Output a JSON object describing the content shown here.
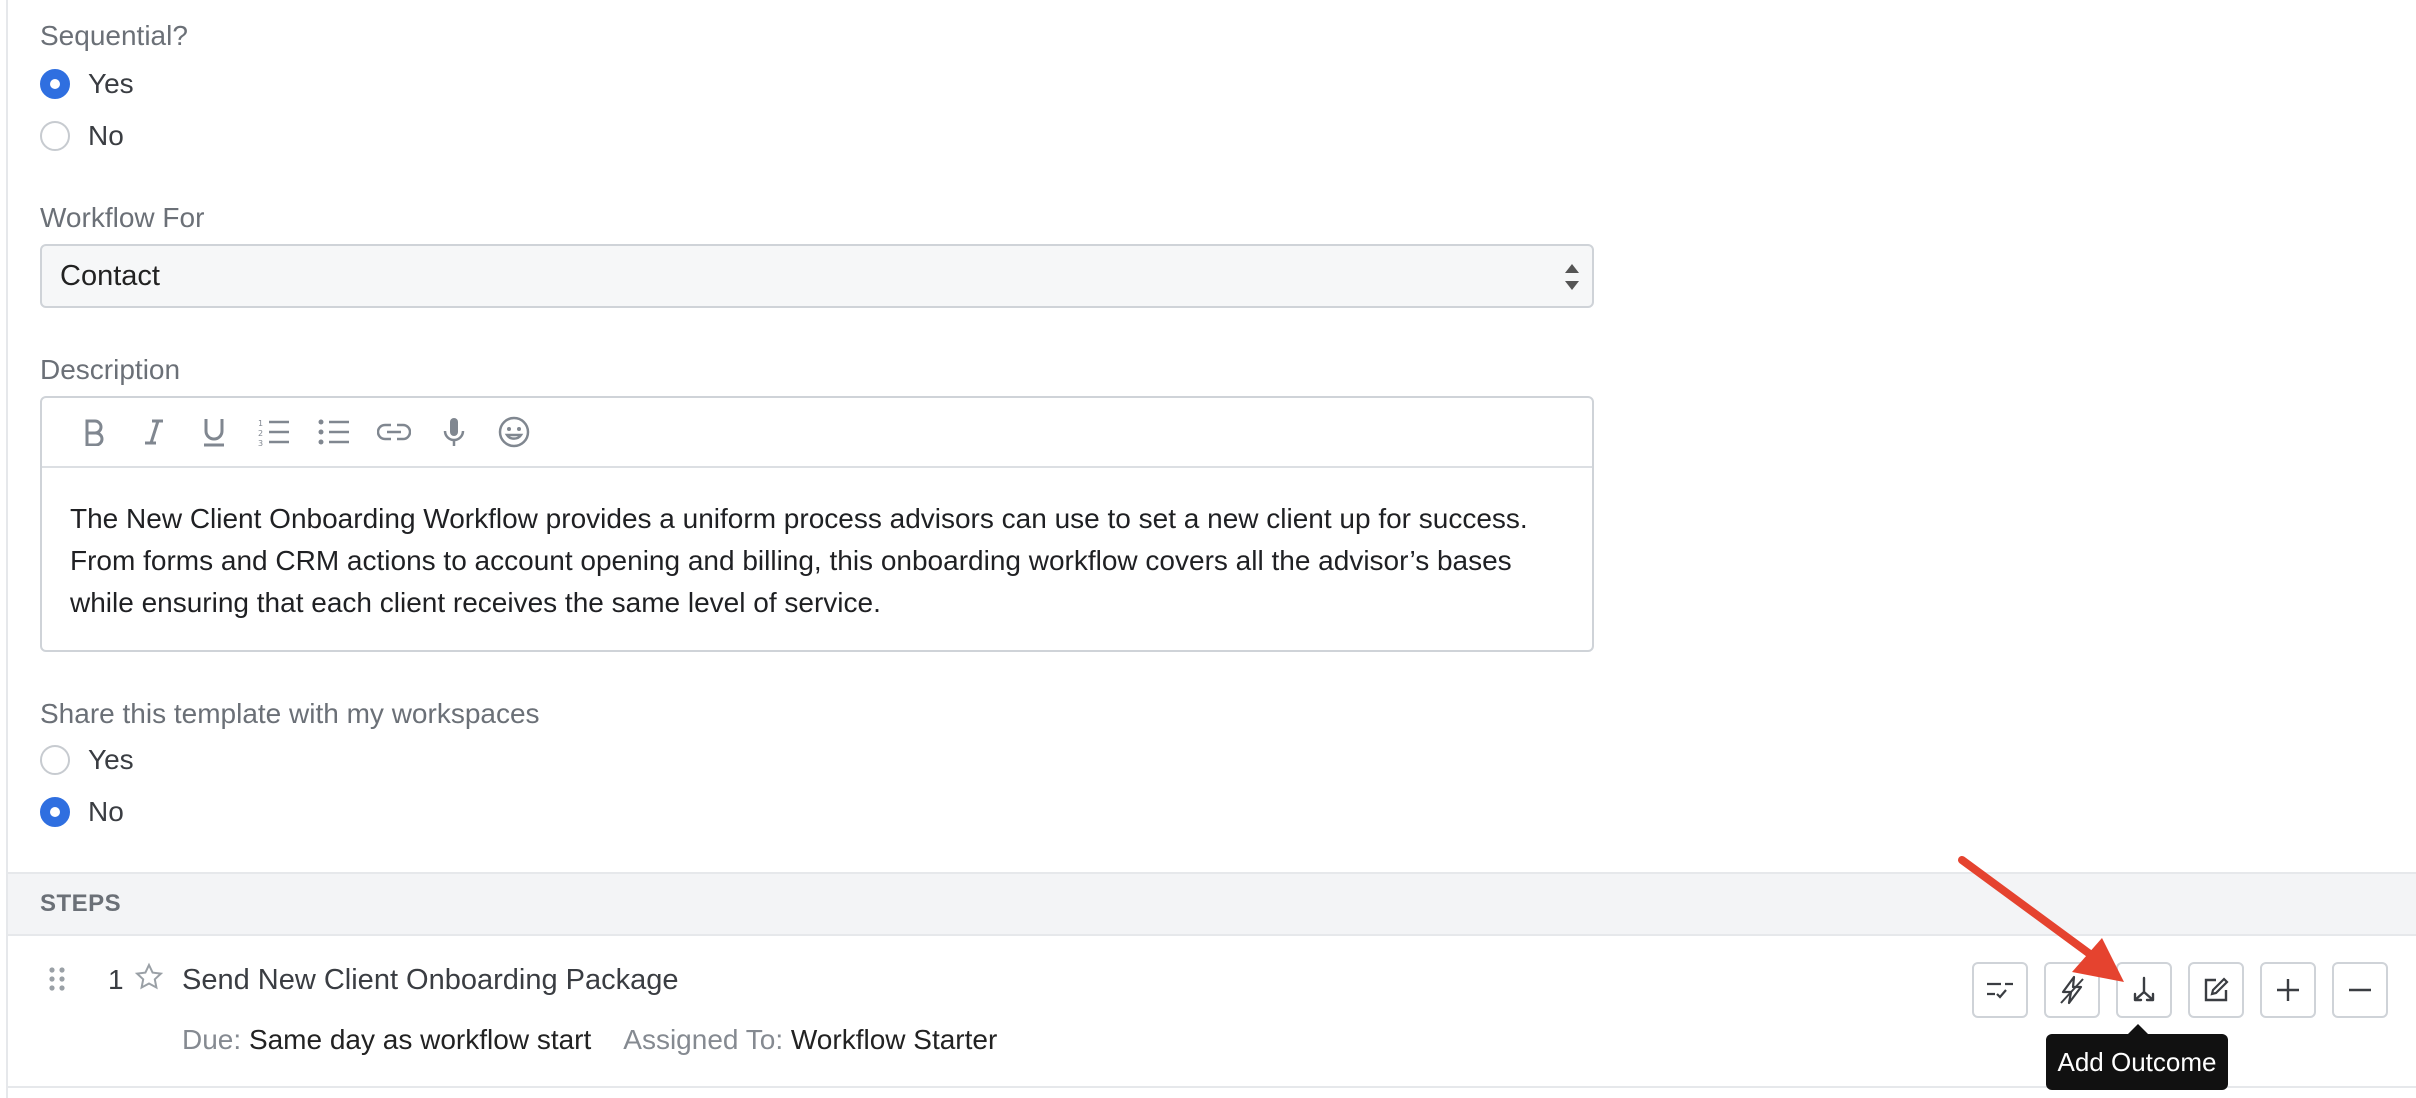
{
  "sequential": {
    "label": "Sequential?",
    "options": [
      {
        "label": "Yes",
        "checked": true
      },
      {
        "label": "No",
        "checked": false
      }
    ]
  },
  "workflow_for": {
    "label": "Workflow For",
    "value": "Contact"
  },
  "description": {
    "label": "Description",
    "toolbar": [
      "bold-icon",
      "italic-icon",
      "underline-icon",
      "ordered-list-icon",
      "bullet-list-icon",
      "link-icon",
      "microphone-icon",
      "emoji-icon"
    ],
    "text": "The New Client Onboarding Workflow provides a uniform process advisors can use to set a new client up for success. From forms and CRM actions to account opening and billing, this onboarding workflow covers all the advisor’s bases while ensuring that each client receives the same level of service."
  },
  "share": {
    "label": "Share this template with my workspaces",
    "options": [
      {
        "label": "Yes",
        "checked": false
      },
      {
        "label": "No",
        "checked": true
      }
    ]
  },
  "steps": {
    "header": "STEPS",
    "items": [
      {
        "number": "1",
        "title": "Send New Client Onboarding Package",
        "due_label": "Due:",
        "due_value": "Same day as workflow start",
        "assigned_label": "Assigned To:",
        "assigned_value": "Workflow Starter"
      }
    ],
    "actions": [
      "checklist-icon",
      "lightning-icon",
      "branch-icon",
      "edit-icon",
      "plus-icon",
      "minus-icon"
    ]
  },
  "tooltip": "Add Outcome",
  "colors": {
    "accent": "#2f6fe0",
    "annotation_arrow": "#e5432f"
  }
}
